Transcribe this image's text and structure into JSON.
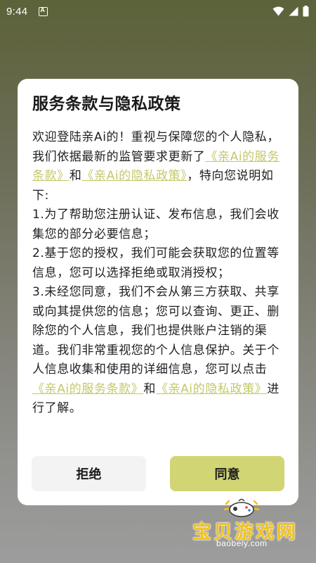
{
  "status_bar": {
    "time": "9:44"
  },
  "dialog": {
    "title": "服务条款与隐私政策",
    "intro": "欢迎登陆亲Ai的！重视与保障您的个人隐私，我们依据最新的监管要求更新了",
    "link_terms": "《亲Ai的服务条款》",
    "and_1": "和",
    "link_privacy": "《亲Ai的隐私政策》",
    "after_links": "，特向您说明如下:",
    "item_1": "1.为了帮助您注册认证、发布信息，我们会收集您的部分必要信息；",
    "item_2": "2.基于您的授权，我们可能会获取您的位置等信息，您可以选择拒绝或取消授权；",
    "item_3": "3.未经您同意，我们不会从第三方获取、共享或向其提供您的信息；您可以查询、更正、删除您的个人信息，我们也提供账户注销的渠道。我们非常重视您的个人信息保护。关于个人信息收集和使用的详细信息，您可以点击",
    "link_terms_2": "《亲Ai的服务条款》",
    "and_2": "和",
    "link_privacy_2": "《亲Ai的隐私政策》",
    "outro": "进行了解。",
    "reject_label": "拒绝",
    "agree_label": "同意"
  },
  "watermark": {
    "text": "宝贝游戏网",
    "url": "baobeiy.com"
  },
  "colors": {
    "link": "#c4c86a",
    "agree_button": "#d2d574",
    "reject_button": "#f3f3f3",
    "watermark_text": "#f2c21a"
  }
}
